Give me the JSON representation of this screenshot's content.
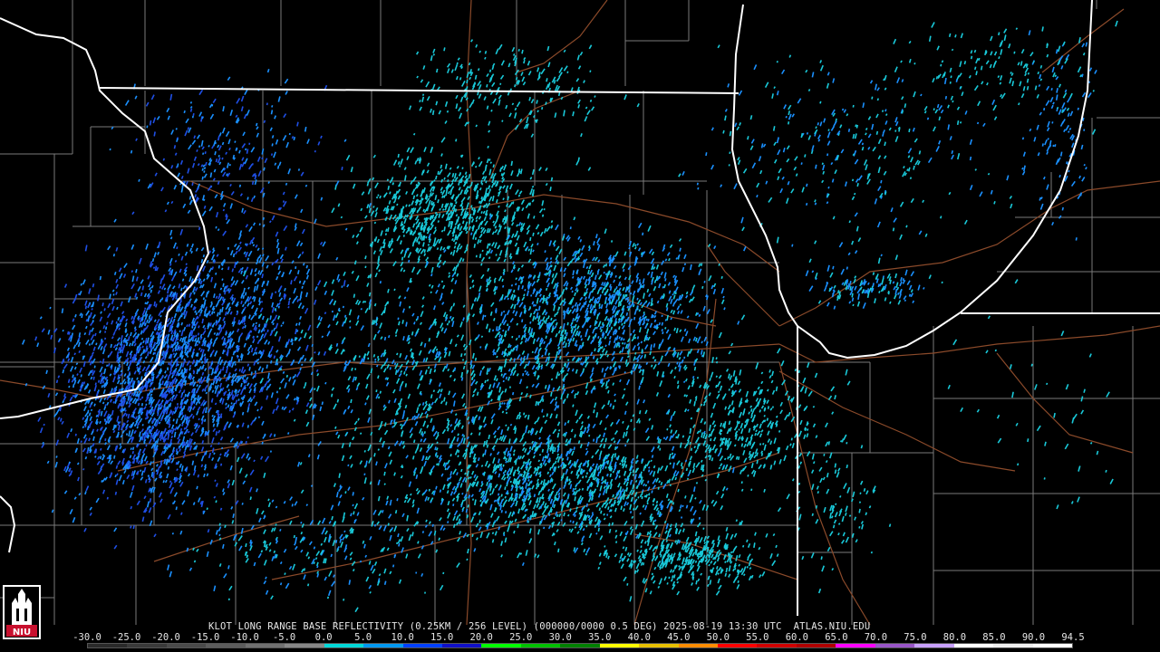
{
  "caption": "KLOT LONG RANGE BASE REFLECTIVITY (0.25KM / 256 LEVEL) (000000/0000 0.5 DEG) 2025-08-19 13:30 UTC  ATLAS.NIU.EDU",
  "logo": {
    "text": "NIU",
    "color": "#c8102e"
  },
  "scale": {
    "labels": [
      "-30.0",
      "-25.0",
      "-20.0",
      "-15.0",
      "-10.0",
      "-5.0",
      "0.0",
      "5.0",
      "10.0",
      "15.0",
      "20.0",
      "25.0",
      "30.0",
      "35.0",
      "40.0",
      "45.0",
      "50.0",
      "55.0",
      "60.0",
      "65.0",
      "70.0",
      "75.0",
      "80.0",
      "85.0",
      "90.0",
      "94.5"
    ],
    "colors": [
      "#2a2a2a",
      "#3a3a3a",
      "#4a4a4a",
      "#5c5c5c",
      "#707070",
      "#888888",
      "#00d8d8",
      "#0098f0",
      "#0040ff",
      "#1010c8",
      "#00ff00",
      "#00c000",
      "#008000",
      "#ffff00",
      "#e8c000",
      "#ff8c00",
      "#ff0000",
      "#d00000",
      "#b00000",
      "#ff00ff",
      "#9955c8",
      "#c8a0ff",
      "#ffffff",
      "#f0f0f0",
      "#ffffff"
    ]
  },
  "map_colors": {
    "state_border": "#ffffff",
    "county_border": "#7a7a7a",
    "highway": "#8b4a2a",
    "echo_light": "#19c9d9",
    "echo_mid": "#1a90ff",
    "echo_dark": "#1f4fe6"
  }
}
